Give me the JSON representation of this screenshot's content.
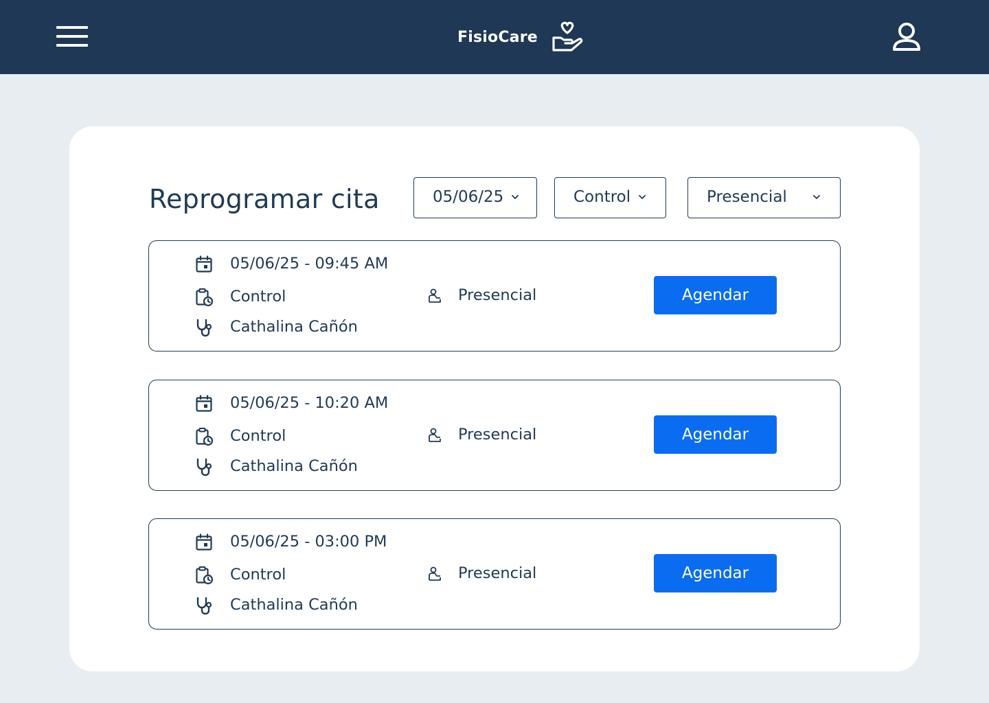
{
  "header": {
    "brand_name": "FisioCare",
    "menu_icon": "hamburger-menu-icon",
    "logo_icon": "heart-in-hand-icon",
    "profile_icon": "user-profile-icon",
    "background_color": "#1e3856"
  },
  "page": {
    "title": "Reprogramar cita",
    "background_color": "#e8edf2"
  },
  "filters": {
    "date": {
      "selected": "05/06/25",
      "icon": "chevron-down-icon"
    },
    "appointment_type": {
      "selected": "Control",
      "icon": "chevron-down-icon"
    },
    "modality": {
      "selected": "Presencial",
      "icon": "chevron-down-icon"
    }
  },
  "slots": [
    {
      "datetime": "05/06/25 - 09:45 AM",
      "type": "Control",
      "professional": "Cathalina Cañón",
      "modality": "Presencial",
      "action_label": "Agendar"
    },
    {
      "datetime": "05/06/25 - 10:20 AM",
      "type": "Control",
      "professional": "Cathalina Cañón",
      "modality": "Presencial",
      "action_label": "Agendar"
    },
    {
      "datetime": "05/06/25 - 03:00 PM",
      "type": "Control",
      "professional": "Cathalina Cañón",
      "modality": "Presencial",
      "action_label": "Agendar"
    }
  ],
  "colors": {
    "primary_button": "#0a6cf1",
    "text": "#1f3a56"
  }
}
